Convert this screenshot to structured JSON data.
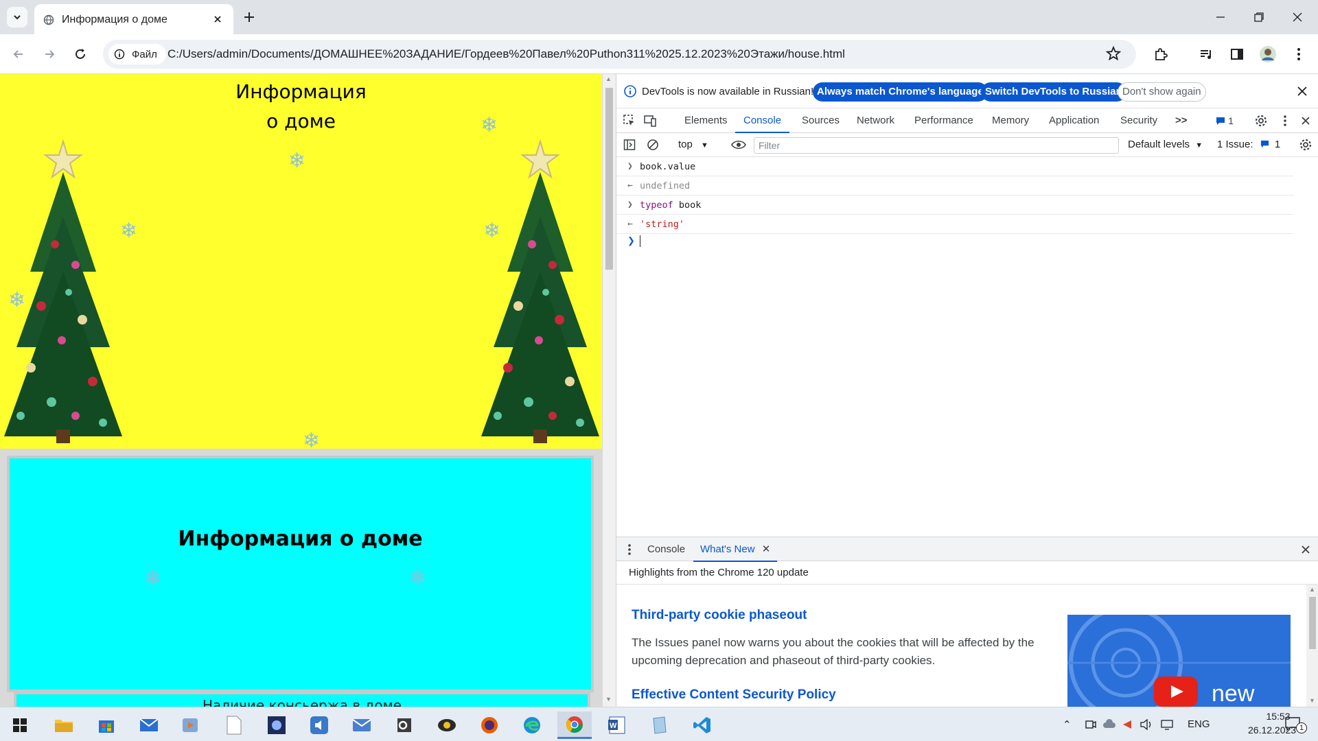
{
  "browser": {
    "tab_title": "Информация о доме",
    "site_chip": "Файл",
    "url": "C:/Users/admin/Documents/ДОМАШНЕЕ%20ЗАДАНИЕ/Гордеев%20Павел%20Puthon311%2025.12.2023%20Этажи/house.html"
  },
  "page": {
    "heading_line1": "Информация",
    "heading_line2": "о доме",
    "cyan_heading": "Информация о доме",
    "inner_box_label": "Наличие консьержа в доме"
  },
  "devtools": {
    "infobar": {
      "message": "DevTools is now available in Russian!",
      "btn_match": "Always match Chrome's language",
      "btn_switch": "Switch DevTools to Russian",
      "btn_dismiss": "Don't show again"
    },
    "tabs": [
      "Elements",
      "Console",
      "Sources",
      "Network",
      "Performance",
      "Memory",
      "Application",
      "Security"
    ],
    "more_tabs": ">>",
    "message_count": "1",
    "console_bar": {
      "context": "top",
      "filter_placeholder": "Filter",
      "levels": "Default levels",
      "issues_label": "1 Issue:",
      "issues_count": "1"
    },
    "log": [
      {
        "kind": "input",
        "text": "book.value"
      },
      {
        "kind": "output",
        "text": "undefined"
      },
      {
        "kind": "input",
        "keyword": "typeof",
        "text": " book"
      },
      {
        "kind": "output",
        "text": "'string'"
      }
    ],
    "drawer": {
      "tab_console": "Console",
      "tab_whats_new": "What's New",
      "highlights": "Highlights from the Chrome 120 update",
      "item1_title": "Third-party cookie phaseout",
      "item1_body": "The Issues panel now warns you about the cookies that will be affected by the upcoming deprecation and phaseout of third-party cookies.",
      "item2_title": "Effective Content Security Policy",
      "promo_word": "new"
    }
  },
  "taskbar": {
    "lang": "ENG",
    "time": "15:53",
    "date": "26.12.2023",
    "notification_count": "1"
  },
  "colors": {
    "page_yellow": "#ffff2e",
    "page_cyan": "#00ffff",
    "devtools_accent": "#0b57d0"
  }
}
